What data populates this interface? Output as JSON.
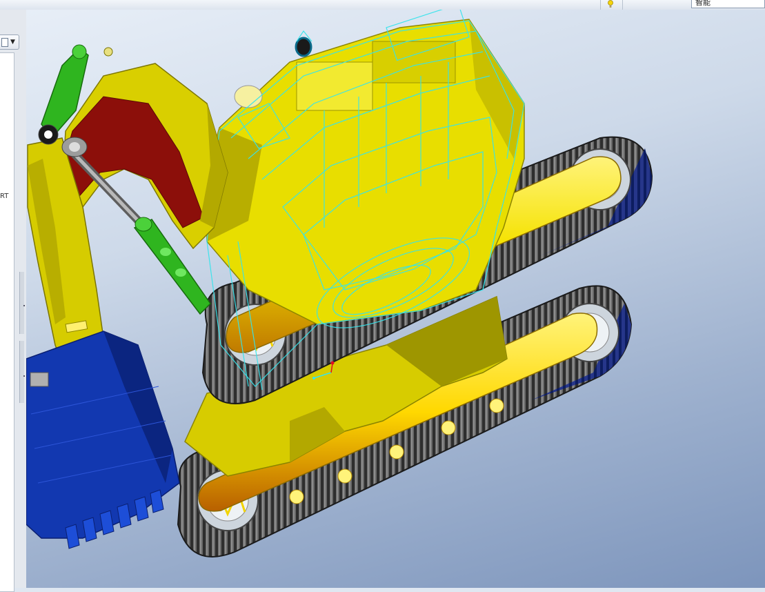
{
  "toolbar": {
    "filter_value": "智能"
  },
  "left_panel": {
    "tree_label_fragment": "RT"
  },
  "icons": [
    "lightbulb-icon",
    "model-tree-icon",
    "dropdown-arrow-icon"
  ],
  "model": {
    "description_colors": {
      "boom": "#d6cc00",
      "boom_face": "#8a0f0a",
      "bucket": "#1238b0",
      "cylinder": "#2fb51f",
      "tracks": "#3a3a3a",
      "idlers": "#c8d2dc",
      "wireframe": "#37e0e8",
      "body": "#e6dc00"
    }
  }
}
